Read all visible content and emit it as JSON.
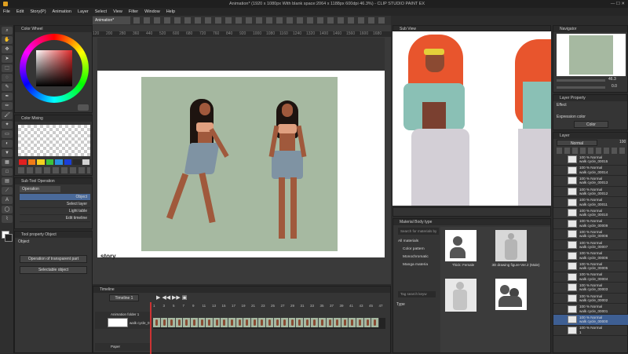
{
  "app": {
    "title": "Animation* (1920 x 1080px With blank space:2064 x 1188px 600dpi 46.3%)  - CLIP STUDIO PAINT EX"
  },
  "menu": [
    "File",
    "Edit",
    "Story(P)",
    "Animation",
    "Layer",
    "Select",
    "View",
    "Filter",
    "Window",
    "Help"
  ],
  "canvas": {
    "tab": "Animation*",
    "ruler_ticks": [
      "120",
      "200",
      "280",
      "360",
      "440",
      "520",
      "600",
      "680",
      "720",
      "760",
      "840",
      "920",
      "1000",
      "1080",
      "1160",
      "1240",
      "1320",
      "1400",
      "1460",
      "1560",
      "1600",
      "1680"
    ],
    "story_text": "story"
  },
  "left": {
    "color_wheel_title": "Color Wheel",
    "color_mixing_title": "Color Mixing",
    "sub_tool_title": "Sub Tool Operation",
    "sub_tool_tab": "Operation",
    "sub_tool_items": [
      "Object",
      "Select layer",
      "Light table",
      "Edit timeline"
    ],
    "tool_prop_title": "Tool property Object",
    "tool_prop_name": "Object",
    "op_transparent": "Operation of transparent part",
    "selectable_object": "Selectable object",
    "swatches": [
      "#e02020",
      "#f07a18",
      "#f5d020",
      "#3cc33c",
      "#2a8fe0",
      "#1a3fd8",
      "#2a2a2a",
      "#d2d2d2"
    ]
  },
  "subview": {
    "title": "Sub View"
  },
  "material": {
    "title": "Material Body type",
    "search_placeholder": "Search for materials by",
    "tree": [
      "All materials",
      "Color pattern",
      "Monochromatic",
      "Manga materia"
    ],
    "tag_search": "Tag search keyw",
    "type_label": "Type",
    "items": [
      "Thick: Female",
      "3D drawing figure-Ver.2 (Male)",
      "",
      ""
    ]
  },
  "navigator": {
    "title": "Navigator",
    "zoom": "46.3",
    "angle": "0.0"
  },
  "layer_property": {
    "title": "Layer Property",
    "effect_label": "Effect",
    "expression_color_label": "Expression color",
    "expression_color_value": "Color"
  },
  "layer": {
    "title": "Layer",
    "blend": "Normal",
    "opacity": "100",
    "items": [
      {
        "mode": "100 % Normal",
        "name": "walk cycle_00015"
      },
      {
        "mode": "100 % Normal",
        "name": "walk cycle_00014"
      },
      {
        "mode": "100 % Normal",
        "name": "walk cycle_00013"
      },
      {
        "mode": "100 % Normal",
        "name": "walk cycle_00012"
      },
      {
        "mode": "100 % Normal",
        "name": "walk cycle_00011"
      },
      {
        "mode": "100 % Normal",
        "name": "walk cycle_00010"
      },
      {
        "mode": "100 % Normal",
        "name": "walk cycle_00009"
      },
      {
        "mode": "100 % Normal",
        "name": "walk cycle_00008"
      },
      {
        "mode": "100 % Normal",
        "name": "walk cycle_00007"
      },
      {
        "mode": "100 % Normal",
        "name": "walk cycle_00006"
      },
      {
        "mode": "100 % Normal",
        "name": "walk cycle_00005"
      },
      {
        "mode": "100 % Normal",
        "name": "walk cycle_00004"
      },
      {
        "mode": "100 % Normal",
        "name": "walk cycle_00003"
      },
      {
        "mode": "100 % Normal",
        "name": "walk cycle_00002"
      },
      {
        "mode": "100 % Normal",
        "name": "walk cycle_00001"
      },
      {
        "mode": "100 % Normal",
        "name": "walk cycle_00000"
      },
      {
        "mode": "100 % Normal",
        "name": "1"
      }
    ]
  },
  "timeline": {
    "title": "Timeline",
    "name": "Timeline 1",
    "frames": [
      "1",
      "3",
      "5",
      "7",
      "9",
      "11",
      "13",
      "15",
      "17",
      "19",
      "21",
      "23",
      "25",
      "27",
      "29",
      "31",
      "33",
      "35",
      "37",
      "39",
      "41",
      "43",
      "45",
      "47"
    ],
    "tracks": [
      {
        "name": "Animation folder 1",
        "cel": "walk cycle_0"
      },
      {
        "name": "Paper",
        "cel": ""
      }
    ]
  },
  "colors": {
    "accent": "#4a7fd0",
    "art_bg": "#a6b9a1",
    "hair": "#e8552d"
  }
}
